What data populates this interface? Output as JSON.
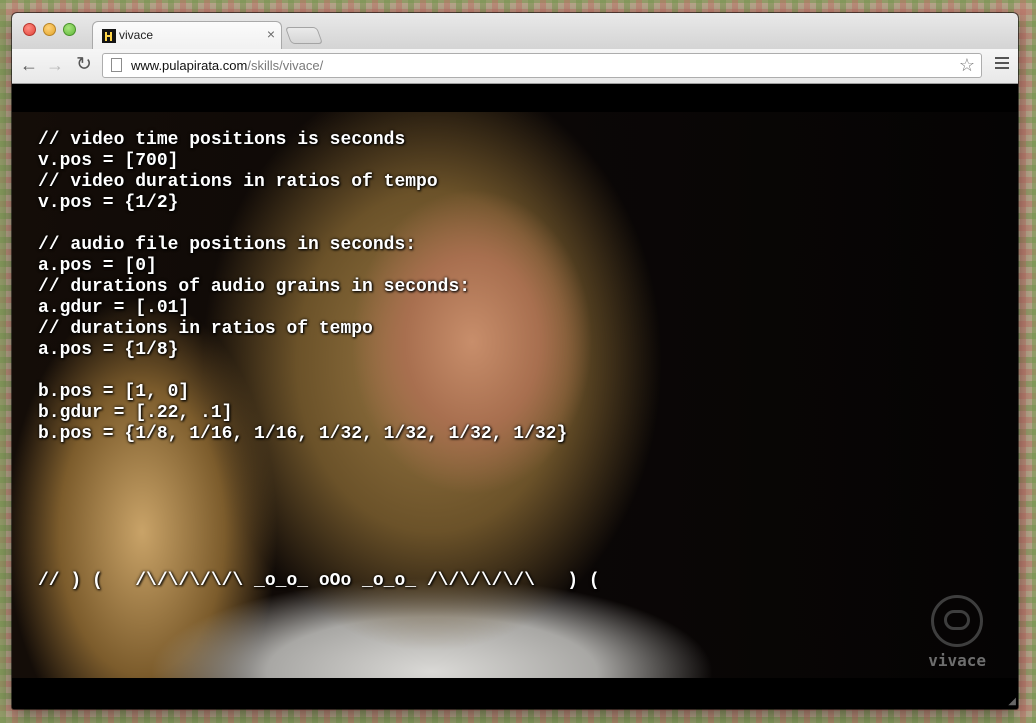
{
  "tab": {
    "title": "vivace",
    "close": "×"
  },
  "address": {
    "host": "www.pulapirata.com",
    "path": "/skills/vivace/"
  },
  "nav": {
    "back": "←",
    "forward": "→",
    "reload": "↻",
    "star": "☆"
  },
  "icons": {
    "favicon": "pirate-favicon-icon",
    "page": "page-icon",
    "bookmark": "star-icon",
    "menu": "menu-icon"
  },
  "video": {
    "watermark": "vivace"
  },
  "code_lines": [
    "// video time positions is seconds",
    "v.pos = [700]",
    "// video durations in ratios of tempo",
    "v.pos = {1/2}",
    "",
    "// audio file positions in seconds:",
    "a.pos = [0]",
    "// durations of audio grains in seconds:",
    "a.gdur = [.01]",
    "// durations in ratios of tempo",
    "a.pos = {1/8}",
    "",
    "b.pos = [1, 0]",
    "b.gdur = [.22, .1]",
    "b.pos = {1/8, 1/16, 1/16, 1/32, 1/32, 1/32, 1/32}"
  ],
  "ascii_line": "// ) (   /\\/\\/\\/\\/\\ _o_o_ oOo _o_o_ /\\/\\/\\/\\/\\   ) ("
}
